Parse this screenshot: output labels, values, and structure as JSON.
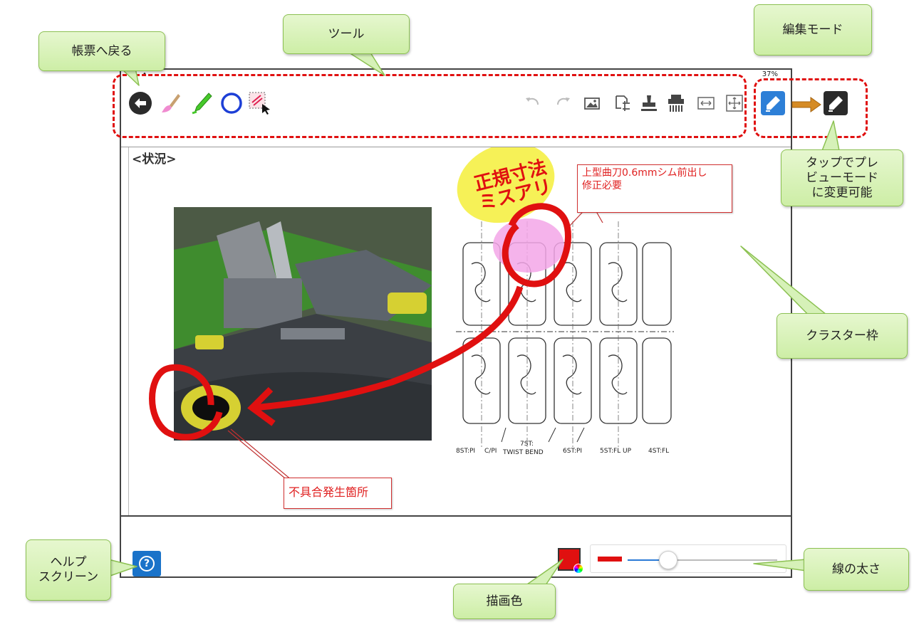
{
  "status": {
    "left": "•",
    "right": "37%"
  },
  "cluster": {
    "title": "<状況>"
  },
  "annotations": {
    "handwriting": "正規寸法\nミスアリ",
    "callout_top": "上型曲刀0.6mmシム前出し\n修正必要",
    "callout_bottom": "不具合発生箇所"
  },
  "drawing_labels": {
    "l1": "8ST:PI",
    "l2": "C/PI",
    "l3": "7ST:",
    "l4": "TWIST BEND",
    "l5": "6ST:PI",
    "l6": "5ST:FL UP",
    "l7": "4ST:FL"
  },
  "bubbles": {
    "back": "帳票へ戻る",
    "tools": "ツール",
    "edit_mode": "編集モード",
    "preview": "タップでプレ\nビューモード\nに変更可能",
    "cluster": "クラスター枠",
    "help": "ヘルプ\nスクリーン",
    "color": "描画色",
    "width": "線の太さ"
  },
  "help": {
    "symbol": "?"
  },
  "colors": {
    "draw": "#e01010",
    "accent": "#1a73c9",
    "highlight_yellow": "#f5ef3a",
    "highlight_pink": "#f3a6e8"
  },
  "line_width": {
    "fraction": 0.27
  },
  "icons": [
    "back-arrow-icon",
    "brush-icon",
    "marker-icon",
    "circle-icon",
    "select-icon",
    "undo-icon",
    "redo-icon",
    "image-icon",
    "crop-icon",
    "stamp-icon",
    "shredder-icon",
    "fit-width-icon",
    "fit-screen-icon",
    "edit-mode-icon",
    "preview-mode-icon"
  ]
}
